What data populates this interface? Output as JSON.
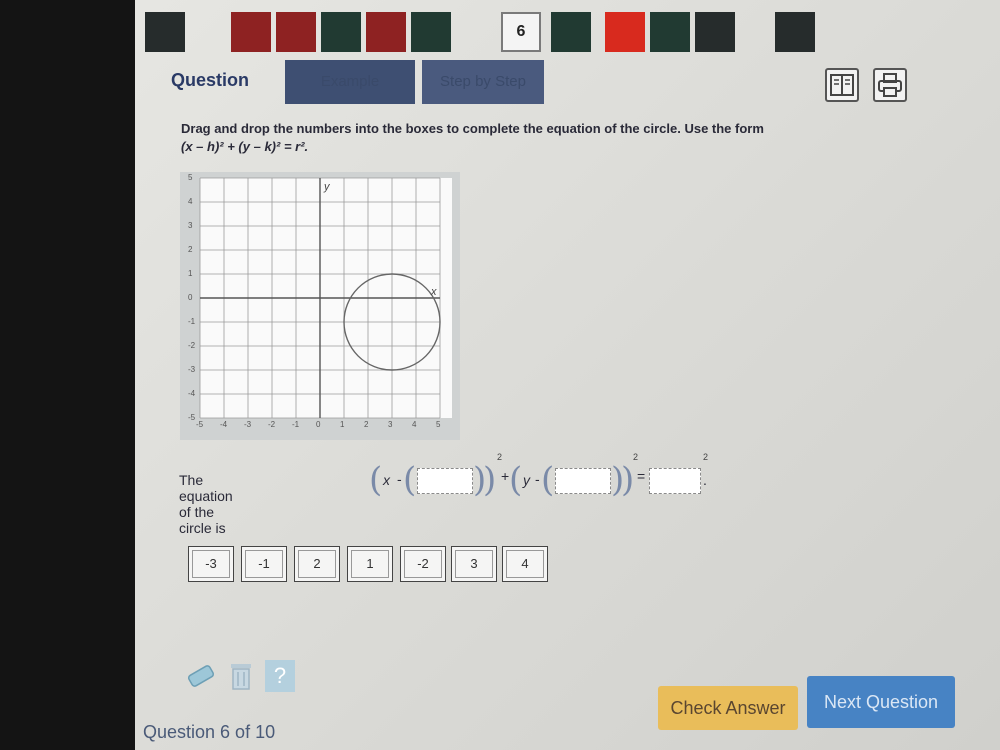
{
  "nav": {
    "current_label": "6",
    "colors": {
      "dark": "#262c2c",
      "red": "#8e2222",
      "green": "#213a32",
      "bright_red": "#d82a1e"
    }
  },
  "tabs": {
    "question": "Question",
    "example": "Example",
    "step_by_step": "Step by Step"
  },
  "toolbar": {
    "glossary_icon": "book-icon",
    "print_icon": "printer-icon"
  },
  "prompt": {
    "line1": "Drag and drop the numbers into the boxes to complete the equation of the circle. Use the form",
    "line2": "(x – h)² + (y – k)² = r²."
  },
  "graph": {
    "x_ticks": [
      "-5",
      "-4",
      "-3",
      "-2",
      "-1",
      "0",
      "1",
      "2",
      "3",
      "4",
      "5"
    ],
    "y_ticks": [
      "5",
      "4",
      "3",
      "2",
      "1",
      "0",
      "-1",
      "-2",
      "-3",
      "-4",
      "-5"
    ],
    "x_label": "x",
    "y_label": "y",
    "circle": {
      "center_x": 3,
      "center_y": -1,
      "radius": 2
    }
  },
  "equation": {
    "lead": "The equation of the circle is",
    "x_var": "x",
    "y_var": "y",
    "minus": "-",
    "plus": "+",
    "equals": "=",
    "exp": "2",
    "period": "."
  },
  "tiles": [
    "-3",
    "-1",
    "2",
    "1",
    "-2",
    "3",
    "4"
  ],
  "bottom_tools": {
    "eraser": "eraser-icon",
    "trash": "trash-icon",
    "help": "?"
  },
  "buttons": {
    "check_answer": "Check Answer",
    "next_question": "Next Question"
  },
  "footer": {
    "counter": "Question 6 of 10"
  }
}
